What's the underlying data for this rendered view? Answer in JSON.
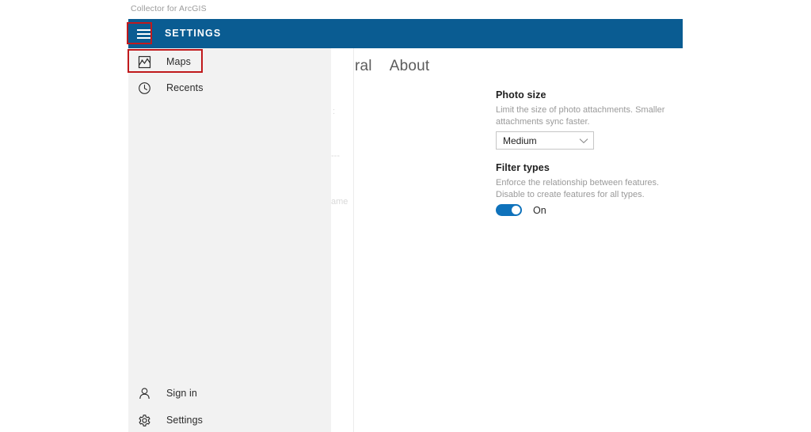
{
  "app": {
    "window_title": "Collector for ArcGIS"
  },
  "header": {
    "title": "SETTINGS",
    "menu_icon": "hamburger-icon",
    "background_color": "#0a5c92"
  },
  "annotations": {
    "highlight_color": "#c0191c",
    "boxes": [
      {
        "target": "hamburger-menu-button"
      },
      {
        "target": "sidebar-item-maps"
      }
    ]
  },
  "sidebar": {
    "background_color": "#f2f2f2",
    "items": [
      {
        "label": "Maps",
        "icon": "map-icon"
      },
      {
        "label": "Recents",
        "icon": "clock-icon"
      }
    ],
    "bottom_items": [
      {
        "label": "Sign in",
        "icon": "person-icon"
      },
      {
        "label": "Settings",
        "icon": "gear-icon"
      }
    ]
  },
  "content": {
    "tabs": [
      {
        "label": "ral",
        "full_label": "General",
        "selected": false,
        "clipped": true
      },
      {
        "label": "About",
        "selected": false,
        "clipped": false
      }
    ],
    "ghost_text": {
      "line1": ":",
      "line2": "---",
      "line3": "ame"
    },
    "settings": [
      {
        "title": "Photo size",
        "description": "Limit the size of photo attachments. Smaller attachments sync faster.",
        "control": "dropdown",
        "value": "Medium",
        "chevron_icon": "chevron-down-icon"
      },
      {
        "title": "Filter types",
        "description": "Enforce the relationship between features. Disable to create features for all types.",
        "control": "toggle",
        "value": "On",
        "toggle_on": true,
        "accent_color": "#0f72bb"
      }
    ]
  }
}
